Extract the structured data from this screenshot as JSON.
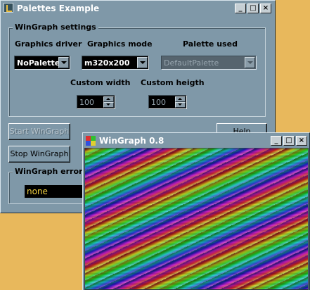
{
  "main_window": {
    "title": "Palettes Example",
    "caption_buttons": {
      "minimize": "_",
      "maximize": "□",
      "close": "×"
    }
  },
  "settings": {
    "group_title": "WinGraph settings",
    "graphics_driver_label": "Graphics driver",
    "graphics_driver_value": "NoPalette",
    "graphics_mode_label": "Graphics mode",
    "graphics_mode_value": "m320x200",
    "palette_label": "Palette used",
    "palette_value": "DefaultPalette",
    "custom_width_label": "Custom width",
    "custom_width_value": "100",
    "custom_height_label": "Custom heigth",
    "custom_height_value": "100"
  },
  "buttons": {
    "start": "Start WinGraph",
    "stop": "Stop WinGraph",
    "help": "Help"
  },
  "error": {
    "group_title": "WinGraph error",
    "value": "none"
  },
  "wingraph_window": {
    "title": "WinGraph 0.8",
    "caption_buttons": {
      "minimize": "_",
      "maximize": "□",
      "close": "×"
    }
  },
  "icons": [
    "app-icon",
    "wingraph-icon",
    "dropdown-arrow-icon",
    "spin-up-icon",
    "spin-down-icon"
  ]
}
